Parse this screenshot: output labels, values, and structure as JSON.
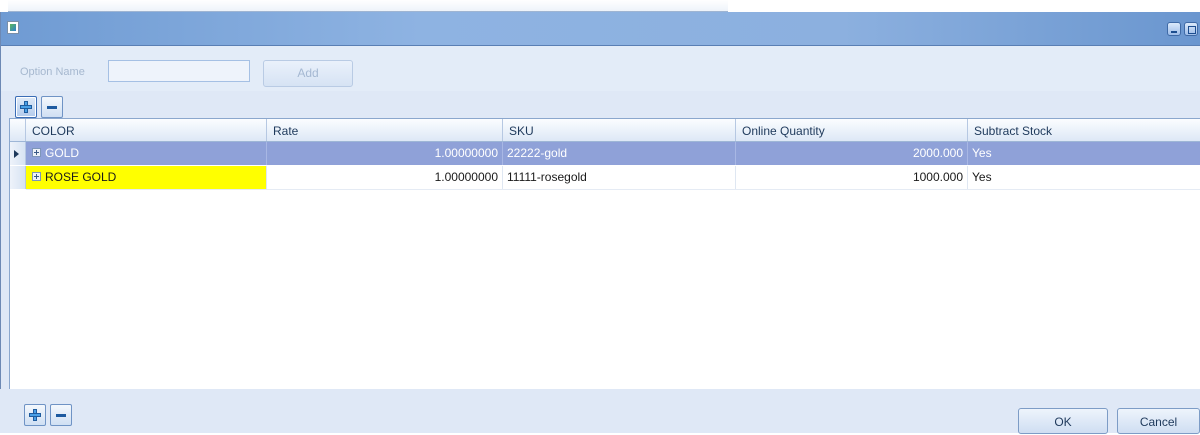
{
  "window": {
    "title": ""
  },
  "options": {
    "name_label": "Option Name",
    "name_value": "",
    "add_label": "Add"
  },
  "grid": {
    "columns": [
      "COLOR",
      "Rate",
      "SKU",
      "Online Quantity",
      "Subtract Stock"
    ],
    "rows": [
      {
        "color": "GOLD",
        "rate": "1.00000000",
        "sku": "22222-gold",
        "online_quantity": "2000.000",
        "subtract_stock": "Yes",
        "selected": true
      },
      {
        "color": "ROSE GOLD",
        "rate": "1.00000000",
        "sku": "11111-rosegold",
        "online_quantity": "1000.000",
        "subtract_stock": "Yes",
        "highlight_color": "#ffff00"
      }
    ]
  },
  "footer": {
    "ok_label": "OK",
    "cancel_label": "Cancel"
  },
  "icons": [
    "app-icon",
    "minimize-icon",
    "maximize-icon",
    "plus-icon",
    "minus-icon",
    "expand-icon",
    "row-pointer-icon"
  ],
  "colors": {
    "selected_row": "#8fa1d8",
    "highlight": "#ffff00",
    "titlebar": "#8eb3e2"
  }
}
